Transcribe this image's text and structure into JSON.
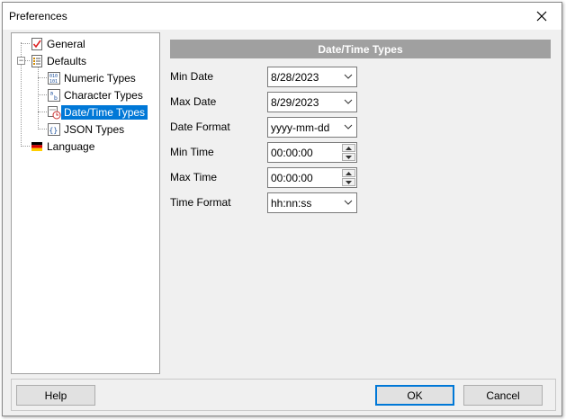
{
  "window": {
    "title": "Preferences"
  },
  "tree": {
    "items": [
      {
        "label": "General",
        "icon": "general-checklist-icon"
      },
      {
        "label": "Defaults",
        "icon": "defaults-list-icon"
      },
      {
        "label": "Numeric Types",
        "icon": "numeric-types-icon"
      },
      {
        "label": "Character Types",
        "icon": "character-types-icon"
      },
      {
        "label": "Date/Time Types",
        "icon": "datetime-types-icon",
        "selected": true
      },
      {
        "label": "JSON Types",
        "icon": "json-types-icon"
      },
      {
        "label": "Language",
        "icon": "language-flag-icon"
      }
    ]
  },
  "panel": {
    "header": "Date/Time Types",
    "fields": [
      {
        "label": "Min Date",
        "value": "8/28/2023",
        "type": "date-dropdown"
      },
      {
        "label": "Max Date",
        "value": "8/29/2023",
        "type": "date-dropdown"
      },
      {
        "label": "Date Format",
        "value": "yyyy-mm-dd",
        "type": "dropdown"
      },
      {
        "label": "Min Time",
        "value": "00:00:00",
        "type": "spinner"
      },
      {
        "label": "Max Time",
        "value": "00:00:00",
        "type": "spinner"
      },
      {
        "label": "Time Format",
        "value": "hh:nn:ss",
        "type": "dropdown"
      }
    ]
  },
  "buttons": {
    "help": "Help",
    "ok": "OK",
    "cancel": "Cancel"
  },
  "colors": {
    "selection": "#0078d7",
    "header_bg": "#a0a0a0",
    "dialog_bg": "#f0f0f0"
  }
}
